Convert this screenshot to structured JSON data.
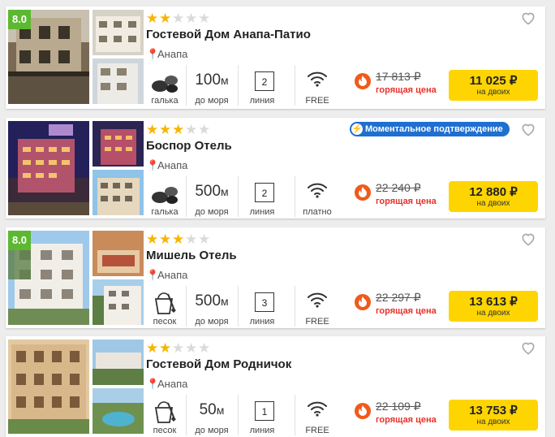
{
  "colors": {
    "rating_bg": "#5cb831",
    "star_on": "#f7b500",
    "badge_bg": "#1f6fd0",
    "buy_bg": "#fed500",
    "hot_text": "#e8312a"
  },
  "cards": [
    {
      "rating": "8.0",
      "stars": 2,
      "name": "Гостевой Дом Анапа-Патио",
      "location": "Анапа",
      "badge": "",
      "beach_icon": "pebbles-icon",
      "beach": "галька",
      "distance_num": "100",
      "distance_unit": "м",
      "distance_label": "до моря",
      "line_num": "2",
      "line_label": "линия",
      "wifi": "FREE",
      "old_price": "17 813 ₽",
      "hot": "горящая цена",
      "price": "11 025 ₽",
      "price_note": "на двоих"
    },
    {
      "rating": "",
      "stars": 3,
      "name": "Боспор Отель",
      "location": "Анапа",
      "badge": "Моментальное подтверждение",
      "beach_icon": "pebbles-icon",
      "beach": "галька",
      "distance_num": "500",
      "distance_unit": "м",
      "distance_label": "до моря",
      "line_num": "2",
      "line_label": "линия",
      "wifi": "платно",
      "old_price": "22 240 ₽",
      "hot": "горящая цена",
      "price": "12 880 ₽",
      "price_note": "на двоих"
    },
    {
      "rating": "8.0",
      "stars": 3,
      "name": "Мишель Отель",
      "location": "Анапа",
      "badge": "",
      "beach_icon": "sand-bucket-icon",
      "beach": "песок",
      "distance_num": "500",
      "distance_unit": "м",
      "distance_label": "до моря",
      "line_num": "3",
      "line_label": "линия",
      "wifi": "FREE",
      "old_price": "22 297 ₽",
      "hot": "горящая цена",
      "price": "13 613 ₽",
      "price_note": "на двоих"
    },
    {
      "rating": "",
      "stars": 2,
      "name": "Гостевой Дом Родничок",
      "location": "Анапа",
      "badge": "",
      "beach_icon": "sand-bucket-icon",
      "beach": "песок",
      "distance_num": "50",
      "distance_unit": "м",
      "distance_label": "до моря",
      "line_num": "1",
      "line_label": "линия",
      "wifi": "FREE",
      "old_price": "22 109 ₽",
      "hot": "горящая цена",
      "price": "13 753 ₽",
      "price_note": "на двоих"
    }
  ]
}
